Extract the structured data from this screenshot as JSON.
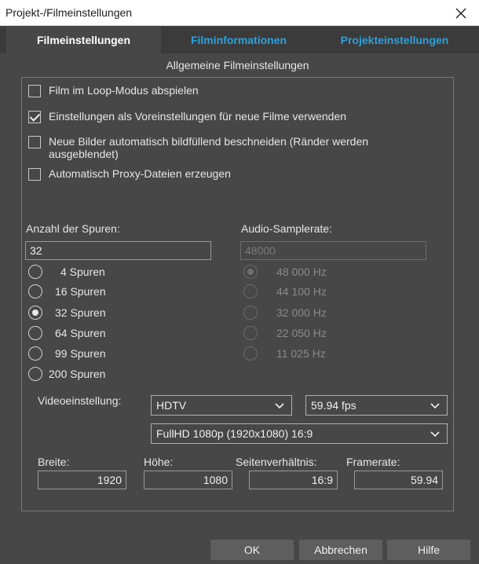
{
  "window": {
    "title": "Projekt-/Filmeinstellungen"
  },
  "tabs": [
    {
      "label": "Filmeinstellungen"
    },
    {
      "label": "Filminformationen"
    },
    {
      "label": "Projekteinstellungen"
    }
  ],
  "section_title": "Allgemeine Filmeinstellungen",
  "options": [
    {
      "label": "Film im Loop-Modus abspielen",
      "checked": false
    },
    {
      "label": "Einstellungen als Voreinstellungen für neue Filme verwenden",
      "checked": true
    },
    {
      "label": "Neue Bilder automatisch bildfüllend beschneiden (Ränder werden ausgeblendet)",
      "checked": false
    },
    {
      "label": "Automatisch Proxy-Dateien erzeugen",
      "checked": false
    }
  ],
  "tracks": {
    "label": "Anzahl der Spuren:",
    "value": "32",
    "options": [
      {
        "label": "4 Spuren",
        "selected": false
      },
      {
        "label": "16 Spuren",
        "selected": false
      },
      {
        "label": "32 Spuren",
        "selected": true
      },
      {
        "label": "64 Spuren",
        "selected": false
      },
      {
        "label": "99 Spuren",
        "selected": false
      },
      {
        "label": "200 Spuren",
        "selected": false
      }
    ]
  },
  "audio": {
    "label": "Audio-Samplerate:",
    "value": "48000",
    "options": [
      {
        "label": "48 000 Hz",
        "selected": true
      },
      {
        "label": "44 100 Hz",
        "selected": false
      },
      {
        "label": "32 000 Hz",
        "selected": false
      },
      {
        "label": "22 050 Hz",
        "selected": false
      },
      {
        "label": "11 025 Hz",
        "selected": false
      }
    ]
  },
  "video": {
    "label": "Videoeinstellung:",
    "standard": "HDTV",
    "fps": "59.94 fps",
    "format": "FullHD 1080p (1920x1080) 16:9"
  },
  "dimensions": {
    "width_label": "Breite:",
    "width_value": "1920",
    "height_label": "Höhe:",
    "height_value": "1080",
    "aspect_label": "Seitenverhältnis:",
    "aspect_value": "16:9",
    "framerate_label": "Framerate:",
    "framerate_value": "59.94"
  },
  "buttons": {
    "ok": "OK",
    "cancel": "Abbrechen",
    "help": "Hilfe"
  },
  "colors": {
    "background": "#474747",
    "tab_link": "#2ea0dd",
    "titlebar": "#ffffff"
  }
}
